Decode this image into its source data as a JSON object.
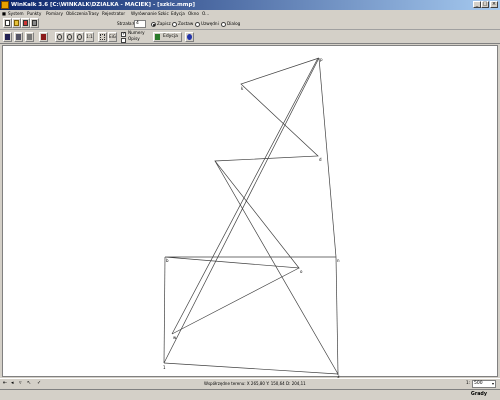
{
  "window": {
    "title": "WinKalk 3.6 [C:\\WINKALK\\DZIALKA - MACIEK] - [szkic.mmp]"
  },
  "menu": [
    "System",
    "Punkty",
    "Pomiary",
    "Obliczenia",
    "Trasy",
    "Rejestrator",
    "Wyrównanie",
    "Szkic",
    "Edycja",
    "Okno",
    "O..."
  ],
  "toolbar": {
    "strzalka_label": "Strzała:65",
    "strzalka_value": "4",
    "zapisz": "Zapisz",
    "zostaw": "Zostaw",
    "uzwedni": "Uzwędni",
    "dialog": "Dialog",
    "zoom_fit": "1:1",
    "grid_btn": "EiG",
    "numery": "Numery",
    "opisy": "Opisy",
    "edycja": "Edycja"
  },
  "canvas": {
    "point_labels": [
      "p",
      "k",
      "d",
      "o",
      "b",
      "n",
      "w",
      "1",
      "3"
    ]
  },
  "status": {
    "coords": "Współrzędne terenu: X 265,80  Y: 150,64  D: 204,11",
    "scale_left": "1:",
    "scale_value": "500",
    "units": "Grady"
  },
  "colors": {
    "title_start": "#0a246a",
    "title_end": "#a6caf0",
    "face": "#d4d0c8",
    "canvas": "#ffffff",
    "line": "#404040"
  }
}
